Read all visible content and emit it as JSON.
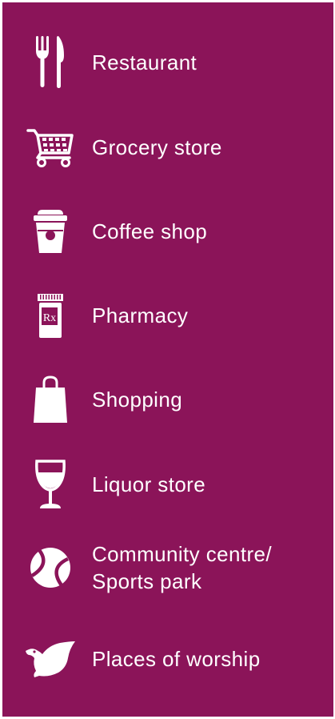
{
  "colors": {
    "panel_background": "#8B1459",
    "foreground": "#FFFFFF"
  },
  "legend": {
    "items": [
      {
        "icon": "fork-knife-icon",
        "label": "Restaurant"
      },
      {
        "icon": "shopping-cart-icon",
        "label": "Grocery store"
      },
      {
        "icon": "coffee-cup-icon",
        "label": "Coffee shop"
      },
      {
        "icon": "prescription-bottle-icon",
        "label": "Pharmacy",
        "icon_text": "Rx"
      },
      {
        "icon": "shopping-bag-icon",
        "label": "Shopping"
      },
      {
        "icon": "wine-glass-icon",
        "label": "Liquor store"
      },
      {
        "icon": "sports-ball-icon",
        "label_line1": "Community centre/",
        "label_line2": "Sports park"
      },
      {
        "icon": "dove-icon",
        "label": "Places of worship"
      }
    ]
  }
}
